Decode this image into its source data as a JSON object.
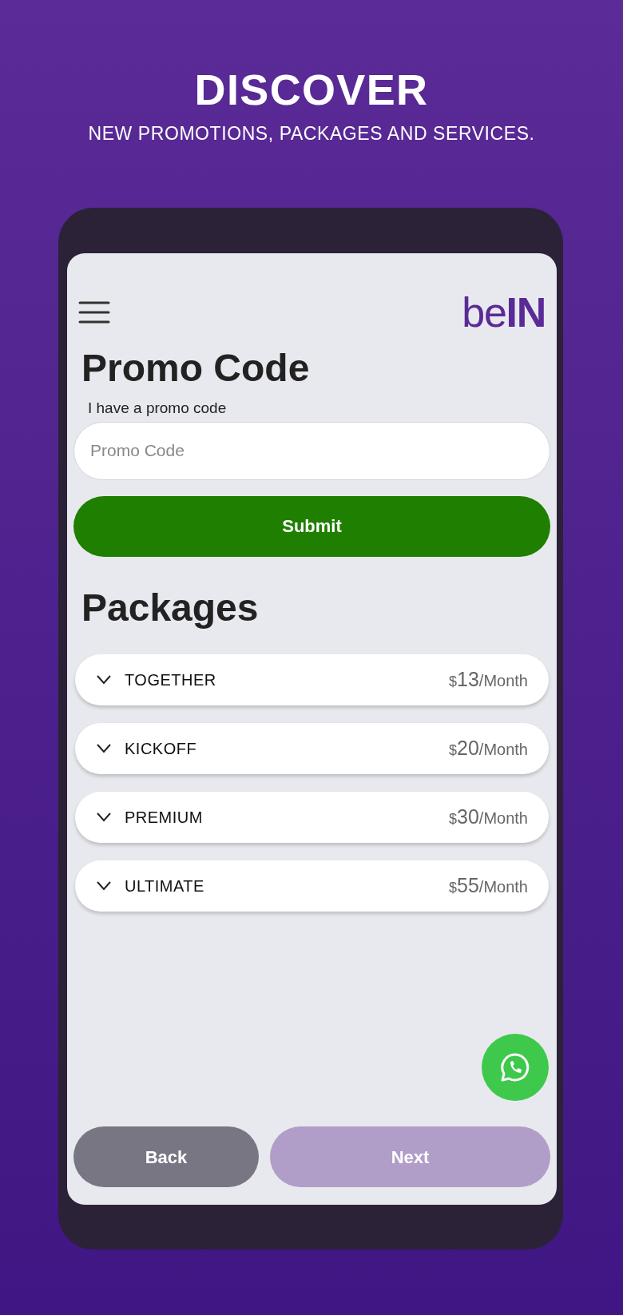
{
  "banner": {
    "headline": "DISCOVER",
    "subtitle": "NEW PROMOTIONS, PACKAGES AND SERVICES."
  },
  "app": {
    "logo": "be**IN**",
    "promo": {
      "title": "Promo Code",
      "label": "I have a promo code",
      "placeholder": "Promo Code",
      "submit": "Submit"
    },
    "packages_title": "Packages",
    "packages": [
      {
        "name": "TOGETHER",
        "currency": "$",
        "amount": "13",
        "period": "/Month",
        "expanded": false
      },
      {
        "name": "KICKOFF",
        "currency": "$",
        "amount": "20",
        "period": "/Month",
        "expanded": false
      },
      {
        "name": "PREMIUM",
        "currency": "$",
        "amount": "30",
        "period": "/Month",
        "expanded": false
      },
      {
        "name": "ULTIMATE",
        "currency": "$",
        "amount": "55",
        "period": "/Month",
        "expanded": false
      }
    ],
    "buttons": [
      {
        "label": "Back",
        "disabled": false
      },
      {
        "label": "Next",
        "disabled": true
      }
    ]
  }
}
